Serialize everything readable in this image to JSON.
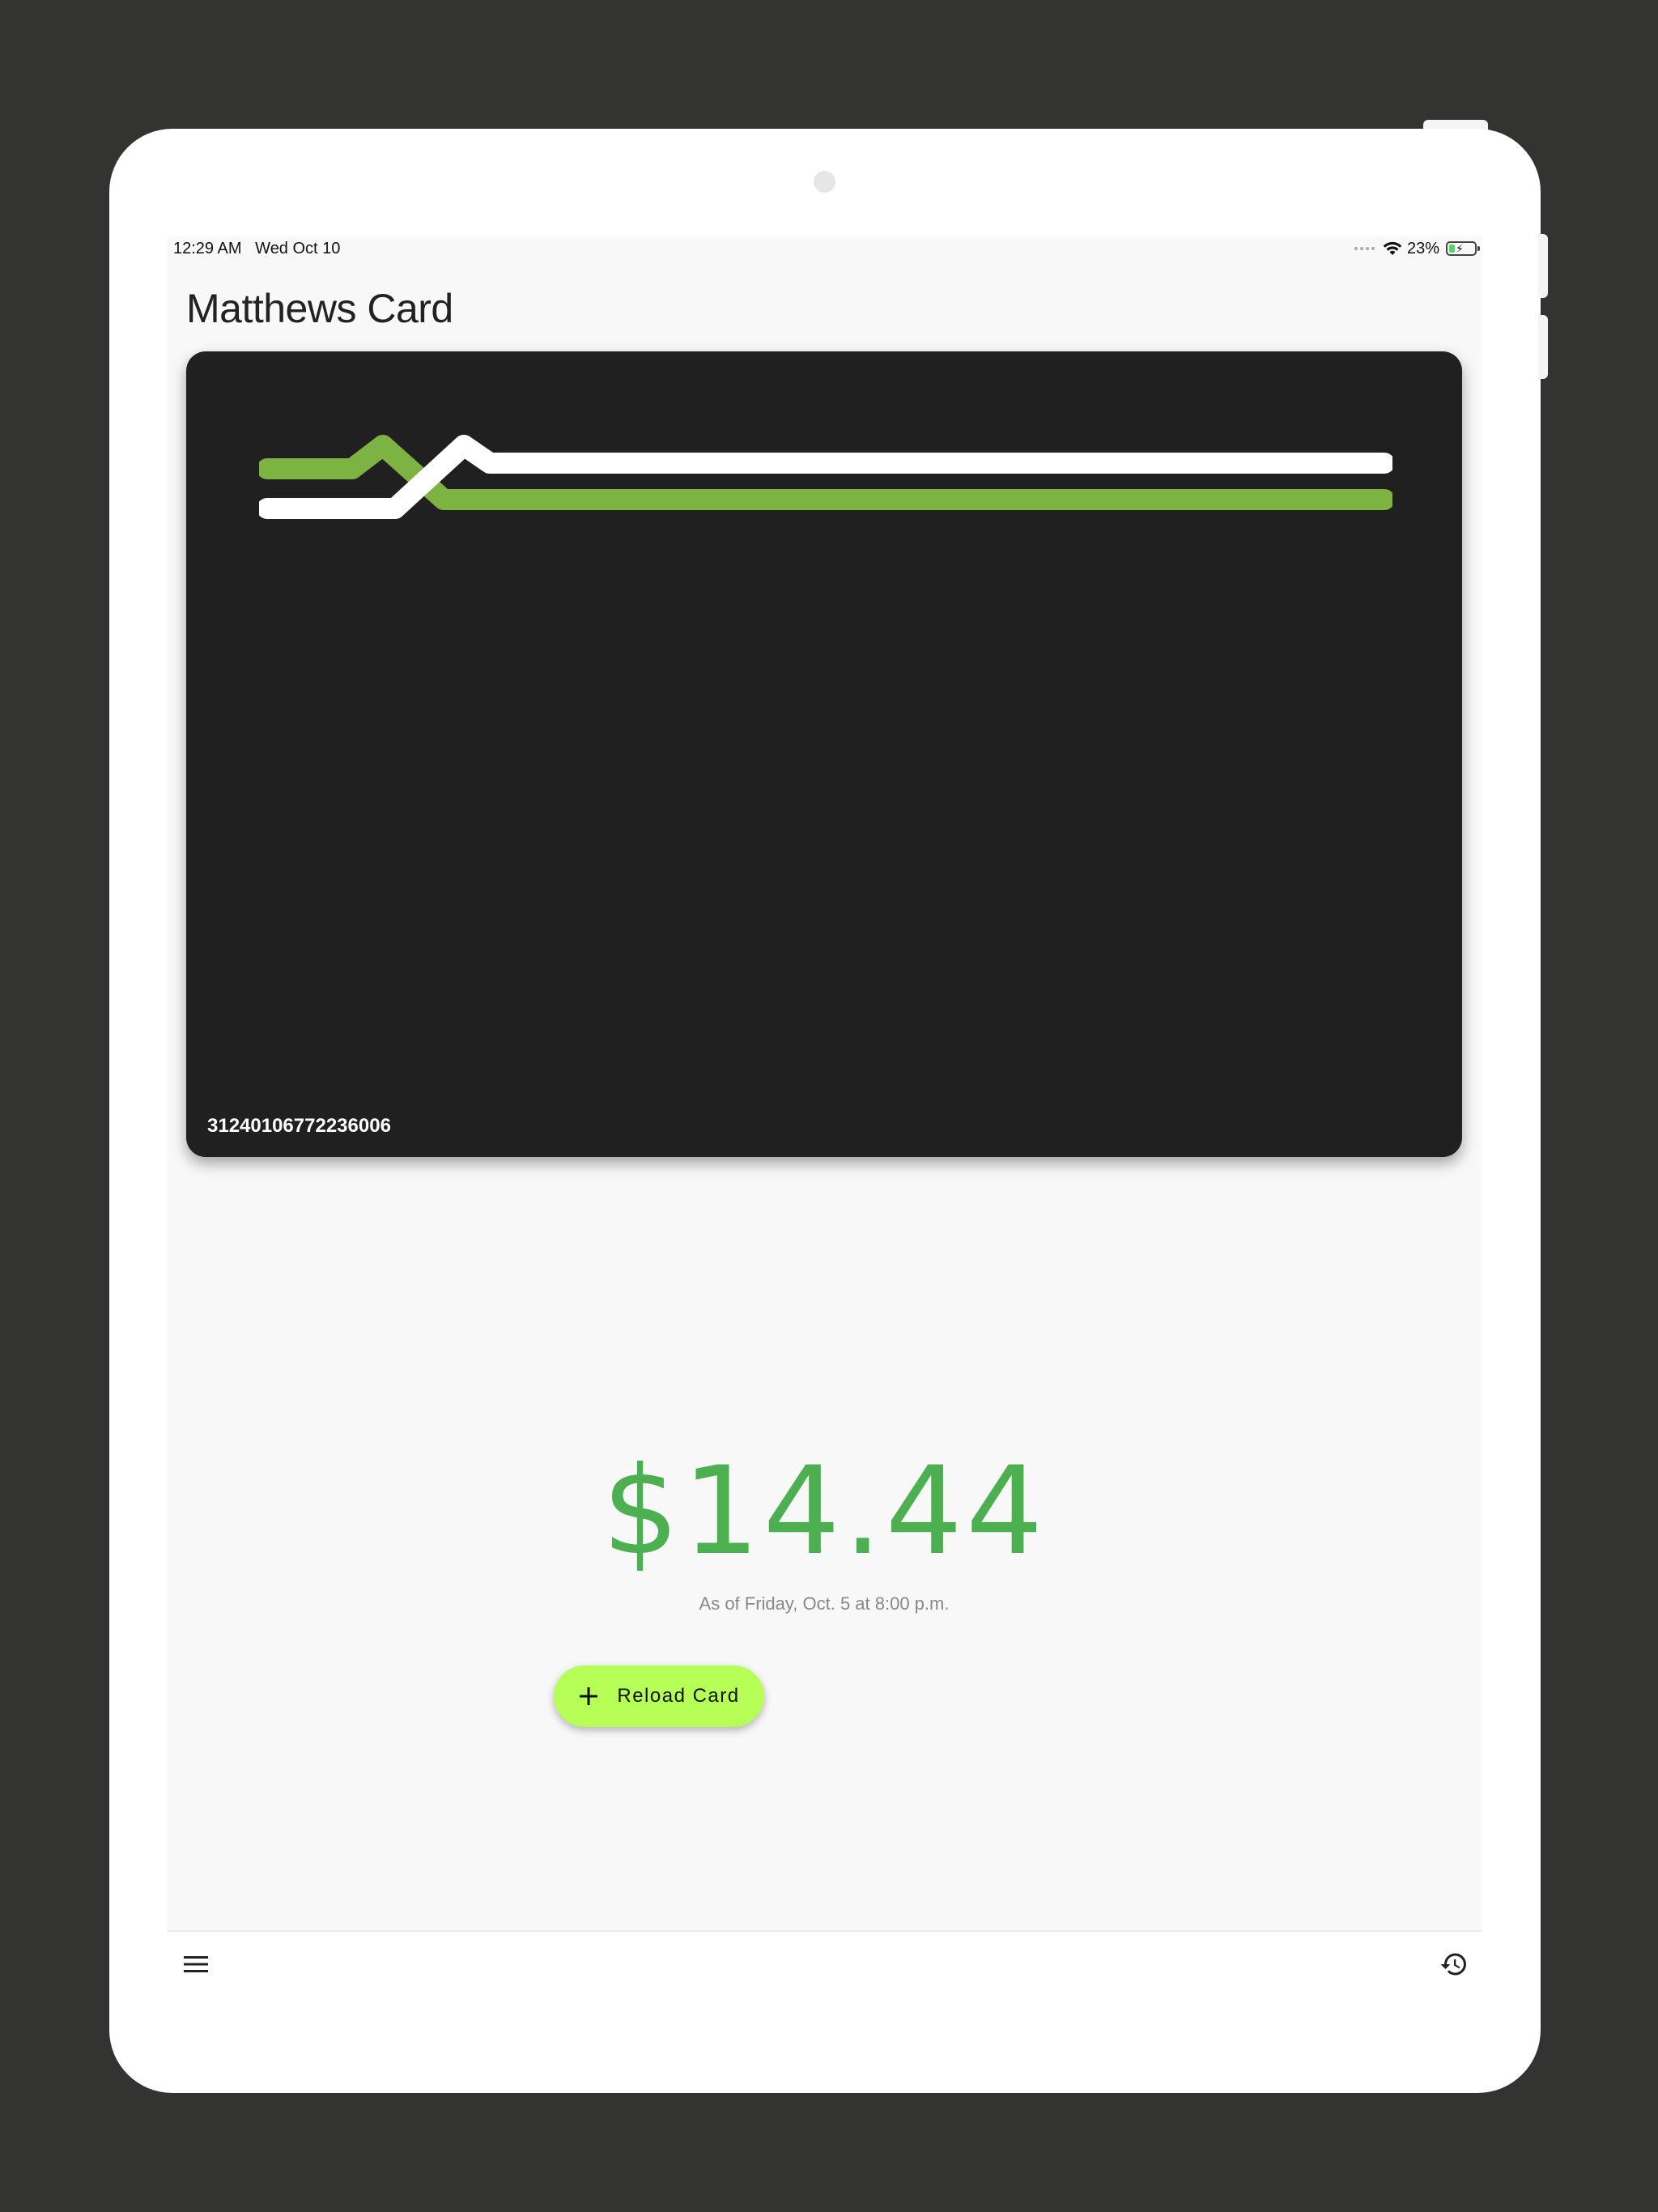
{
  "status_bar": {
    "time": "12:29 AM   Wed Oct 10",
    "battery_percent": "23%",
    "battery_level": 0.23
  },
  "header": {
    "title": "Matthews Card"
  },
  "card": {
    "number": "31240106772236006",
    "colors": {
      "background": "#202020",
      "stripe_green": "#7cb342",
      "stripe_white": "#ffffff"
    }
  },
  "balance": {
    "amount": "$14.44",
    "as_of": "As of Friday, Oct. 5 at 8:00 p.m.",
    "color": "#4caf50"
  },
  "actions": {
    "reload_label": "Reload Card",
    "reload_color": "#b5ff57"
  },
  "icons": {
    "menu": "menu-icon",
    "history": "history-icon",
    "add": "plus-icon",
    "wifi": "wifi-icon",
    "battery": "battery-icon"
  }
}
